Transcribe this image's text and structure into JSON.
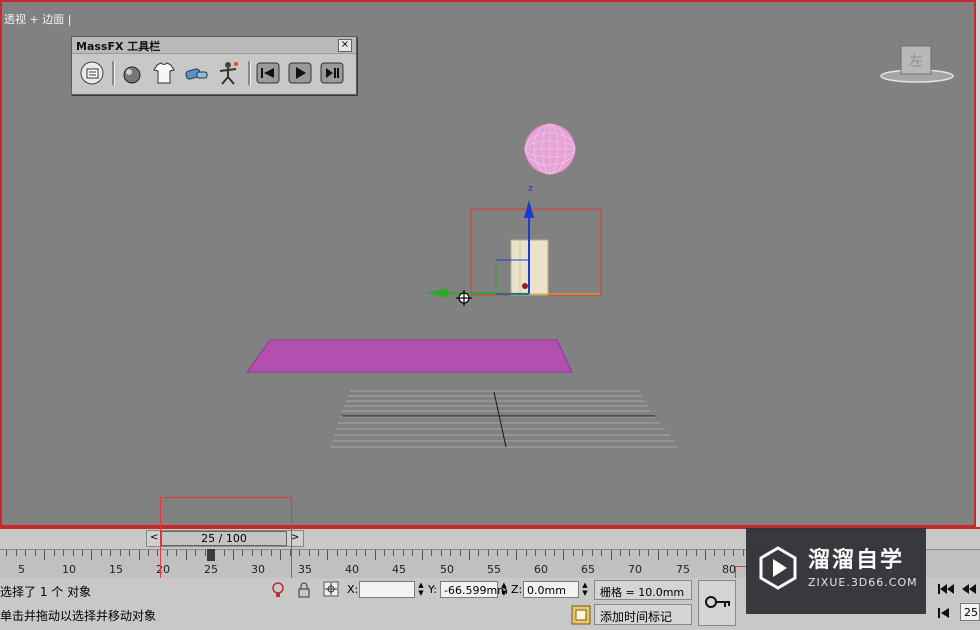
{
  "viewport": {
    "label": "透视 + 边面 |",
    "viewcube_face": "左"
  },
  "massfx_toolbar": {
    "title": "MassFX 工具栏",
    "close": "×",
    "tools": [
      "massfx-tools-icon",
      "rigid-body-sphere-icon",
      "cloth-shirt-icon",
      "constraint-icon",
      "ragdoll-icon",
      "reset-simulation-icon",
      "start-simulation-icon",
      "step-simulation-icon"
    ]
  },
  "scene": {
    "gizmo_axis_z": "z"
  },
  "timeline": {
    "slider_label": "25 / 100",
    "prev": "<",
    "next": ">",
    "ticks": [
      "5",
      "10",
      "15",
      "20",
      "25",
      "30",
      "35",
      "40",
      "45",
      "50",
      "55",
      "60",
      "65",
      "70",
      "75",
      "80"
    ]
  },
  "status": {
    "selection_text": "选择了 1 个 对象",
    "prompt_text": "单击并拖动以选择并移动对象",
    "x_label": "X:",
    "x_value": "",
    "y_label": "Y:",
    "y_value": "-66.599mm",
    "z_label": "Z:",
    "z_value": "0.0mm",
    "grid_text": "栅格 = 10.0mm",
    "add_time_tag": "添加时间标记",
    "frame_field": "25"
  },
  "watermark": {
    "title": "溜溜自学",
    "sub": "ZIXUE.3D66.COM"
  },
  "colors": {
    "viewport_border": "#c62a2a",
    "sphere": "#e9a8d8",
    "plane": "#b04fb0",
    "box": "#e9e1c8"
  }
}
